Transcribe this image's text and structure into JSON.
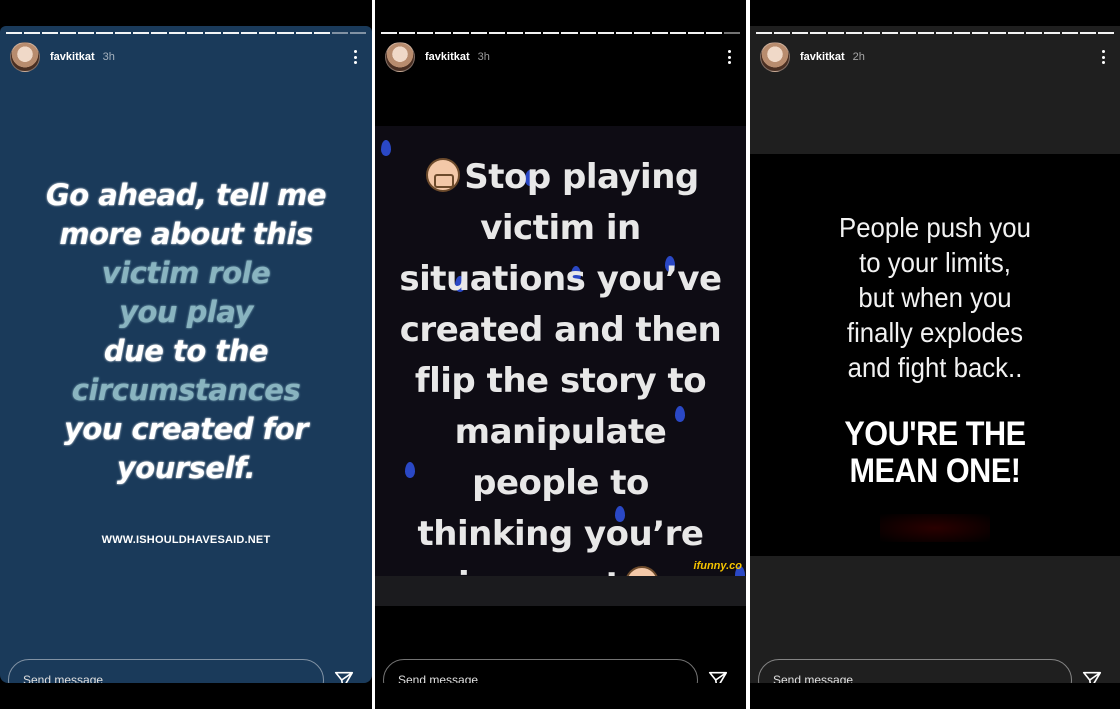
{
  "stories": [
    {
      "username": "favkitkat",
      "time": "3h",
      "send_placeholder": "Send message",
      "quote_lines": [
        {
          "text": "Go ahead, tell me",
          "highlight": false
        },
        {
          "text": "more about this",
          "highlight": false
        },
        {
          "text": "victim role",
          "highlight": true
        },
        {
          "text": "you play",
          "highlight": true
        },
        {
          "text": "due to the",
          "highlight": false
        },
        {
          "text": "circumstances",
          "highlight": true
        },
        {
          "text": "you created for",
          "highlight": false
        },
        {
          "text": "yourself.",
          "highlight": false
        }
      ],
      "site": "WWW.ISHOULDHAVESAID.NET",
      "colors": {
        "background": "#1a3a5a",
        "highlight": "#89b4c0"
      }
    },
    {
      "username": "favkitkat",
      "time": "3h",
      "send_placeholder": "Send message",
      "quote_lines": [
        "Stop playing",
        "victim in",
        "situations you’ve",
        "created and then",
        "flip the story to",
        "manipulate",
        "people to",
        "thinking you’re",
        "innocent"
      ],
      "watermark": "ifunny.co",
      "icons": [
        "facepalm-emoji-icon",
        "tipping-hand-emoji-icon"
      ]
    },
    {
      "username": "favkitkat",
      "time": "2h",
      "send_placeholder": "Send message",
      "quote_lines": [
        "People push you",
        "to your limits,",
        "but when you",
        "finally explodes",
        "and fight back.."
      ],
      "emphasis_lines": [
        "YOU'RE THE",
        "MEAN ONE!"
      ]
    }
  ]
}
